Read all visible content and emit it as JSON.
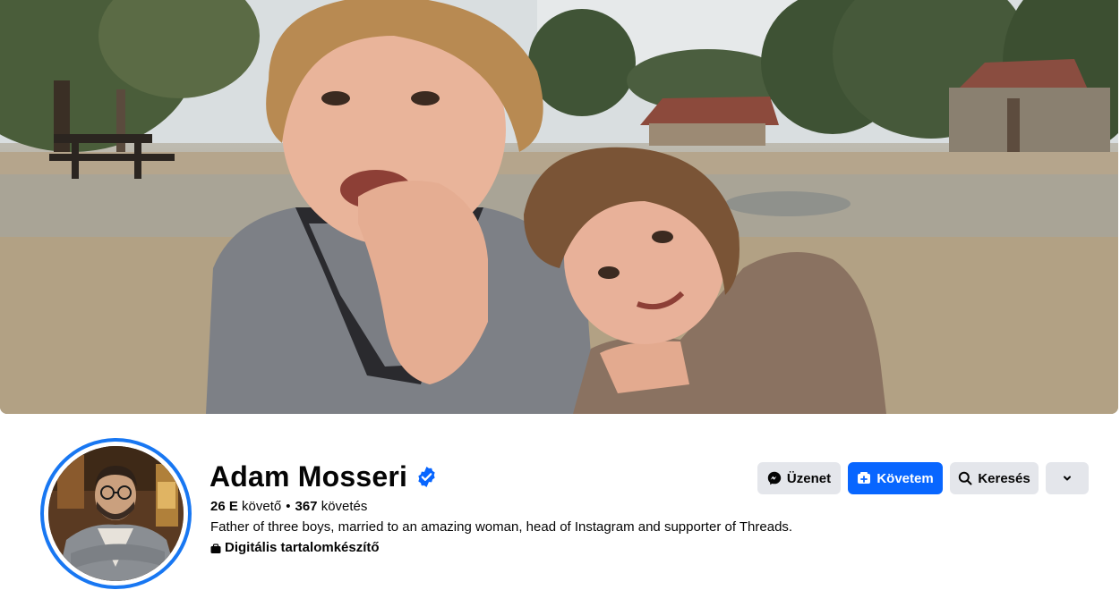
{
  "profile": {
    "name": "Adam Mosseri",
    "verified": true,
    "followers_value": "26 E",
    "followers_label": "követő",
    "separator": "•",
    "following_value": "367",
    "following_label": "követés",
    "bio": "Father of three boys, married to an amazing woman, head of Instagram and supporter of Threads.",
    "category": "Digitális tartalomkészítő"
  },
  "actions": {
    "message_label": "Üzenet",
    "follow_label": "Követem",
    "search_label": "Keresés"
  },
  "colors": {
    "accent": "#0866ff",
    "avatar_ring": "#1877f2",
    "button_gray": "#e4e6eb",
    "verified_badge": "#0866ff"
  },
  "icons": {
    "message": "messenger-icon",
    "follow": "follow-icon",
    "search": "search-icon",
    "more": "chevron-down-icon",
    "verified": "verified-badge-icon",
    "category": "category-icon"
  }
}
